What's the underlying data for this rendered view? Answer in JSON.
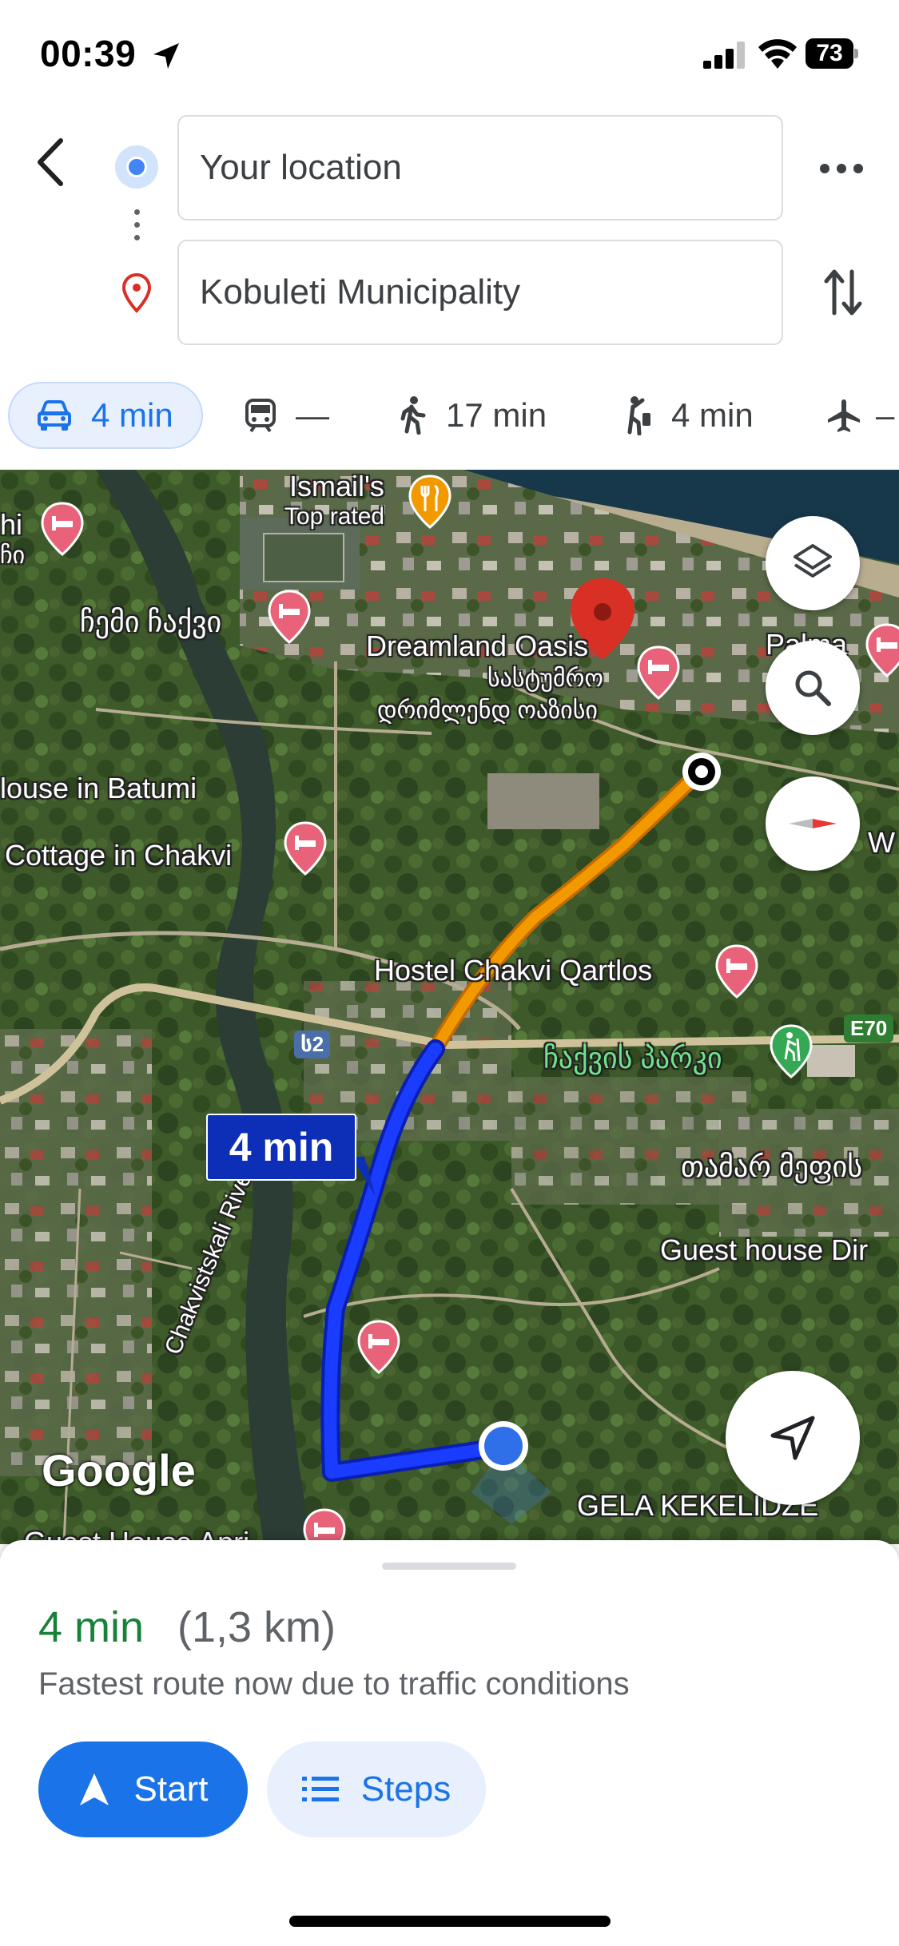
{
  "status_bar": {
    "time": "00:39",
    "battery": "73"
  },
  "directions": {
    "origin": "Your location",
    "destination": "Kobuleti Municipality"
  },
  "travel_modes": [
    {
      "mode": "drive",
      "icon": "car-icon",
      "label": "4 min"
    },
    {
      "mode": "transit",
      "icon": "train-icon",
      "label": "—"
    },
    {
      "mode": "walk",
      "icon": "walk-icon",
      "label": "17 min"
    },
    {
      "mode": "ride",
      "icon": "ride-hail-icon",
      "label": "4 min"
    },
    {
      "mode": "fly",
      "icon": "airplane-icon",
      "label": "–"
    }
  ],
  "map": {
    "labels": {
      "ismails": "Ismail's",
      "top_rated": "Top rated",
      "hi": "hi",
      "ho": "ჩი",
      "chemi_chakvi": "ჩემი ჩაქვი",
      "dreamland": "Dreamland Oasis",
      "dreamland_ka1": "სასტუმრო",
      "dreamland_ka2": "დრიმლენდ ოაზისი",
      "palma": "Palma",
      "house_batumi": "louse in Batumi",
      "cottage_chakvi": "Cottage in Chakvi",
      "w": "W",
      "hostel": "Hostel Chakvi Qartlos",
      "road_s2": "ს2",
      "road_e70": "E70",
      "chakvi_park": "ჩაქვის პარკი",
      "tamar": "თამარ მეფის",
      "guest_house": "Guest house Dir",
      "river": "Chakvistskali River",
      "gela": "GELA KEKELIDZE",
      "guest_house_bottom": "Guest House Apri"
    },
    "route_duration": "4 min",
    "attribution": "Google",
    "colors": {
      "route_primary": "#1a3cff",
      "route_secondary": "#f29900",
      "destination_pin": "#d93025"
    }
  },
  "summary": {
    "duration": "4 min",
    "distance": "(1,3 km)",
    "note": "Fastest route now due to traffic conditions"
  },
  "actions": {
    "start": "Start",
    "steps": "Steps"
  }
}
